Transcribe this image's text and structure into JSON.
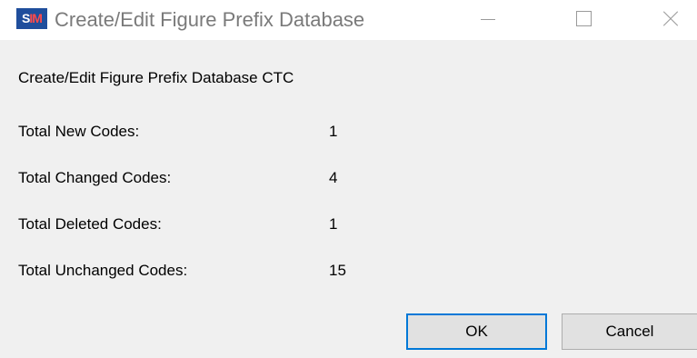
{
  "window": {
    "title": "Create/Edit Figure Prefix Database",
    "icon": "sim-app-icon",
    "icon_text_s": "S",
    "icon_text_m": "IM"
  },
  "dialog": {
    "heading": "Create/Edit Figure Prefix Database CTC",
    "rows": [
      {
        "label": "Total New Codes:",
        "value": "1"
      },
      {
        "label": "Total Changed Codes:",
        "value": "4"
      },
      {
        "label": "Total Deleted Codes:",
        "value": "1"
      },
      {
        "label": "Total Unchanged Codes:",
        "value": "15"
      }
    ],
    "ok_label": "OK",
    "cancel_label": "Cancel"
  },
  "colors": {
    "accent": "#0078d7",
    "icon_bg": "#1f4e9c"
  }
}
